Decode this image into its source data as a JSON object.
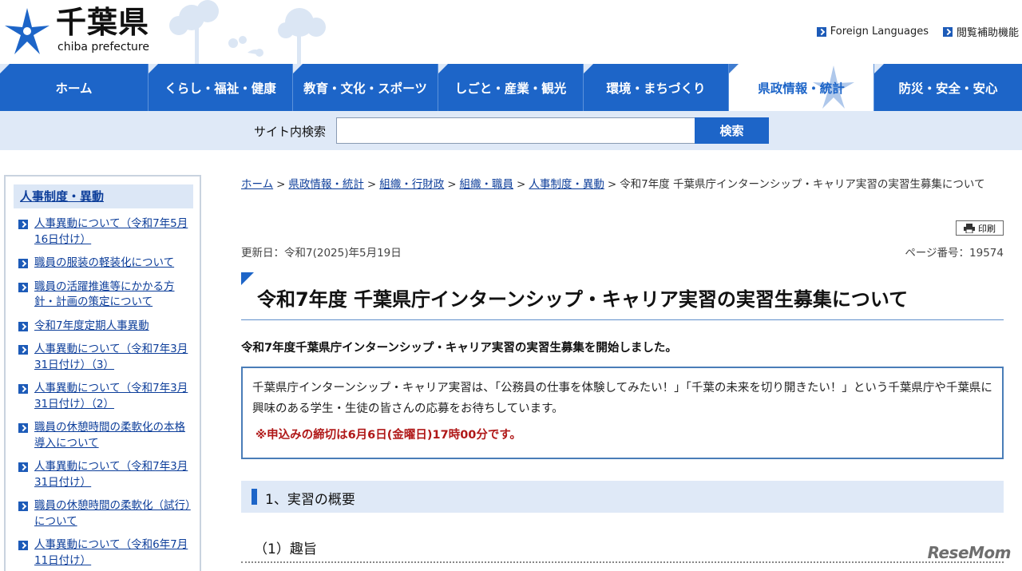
{
  "header": {
    "logo_jp": "千葉県",
    "logo_en": "chiba prefecture",
    "util_links": [
      {
        "label": "Foreign Languages"
      },
      {
        "label": "閲覧補助機能"
      }
    ]
  },
  "gnav": {
    "items": [
      {
        "label": "ホーム"
      },
      {
        "label": "くらし・福祉・健康"
      },
      {
        "label": "教育・文化・スポーツ"
      },
      {
        "label": "しごと・産業・観光"
      },
      {
        "label": "環境・まちづくり"
      },
      {
        "label": "県政情報・統計"
      },
      {
        "label": "防災・安全・安心"
      }
    ],
    "active_index": 5
  },
  "search": {
    "label": "サイト内検索",
    "value": "",
    "button": "検索"
  },
  "sidebar": {
    "heading": "人事制度・異動",
    "items": [
      {
        "label": "人事異動について（令和7年5月16日付け）"
      },
      {
        "label": "職員の服装の軽装化について"
      },
      {
        "label": "職員の活躍推進等にかかる方針・計画の策定について"
      },
      {
        "label": "令和7年度定期人事異動"
      },
      {
        "label": "人事異動について（令和7年3月31日付け）（3）"
      },
      {
        "label": "人事異動について（令和7年3月31日付け）（2）"
      },
      {
        "label": "職員の休憩時間の柔軟化の本格導入について"
      },
      {
        "label": "人事異動について（令和7年3月31日付け）"
      },
      {
        "label": "職員の休憩時間の柔軟化（試行）について"
      },
      {
        "label": "人事異動について（令和6年7月11日付け）"
      }
    ]
  },
  "breadcrumb": {
    "links": [
      "ホーム",
      "県政情報・統計",
      "組織・行財政",
      "組織・職員",
      "人事制度・異動"
    ],
    "separator": ">",
    "current": "令和7年度 千葉県庁インターンシップ・キャリア実習の実習生募集について"
  },
  "print": {
    "label": "印刷"
  },
  "meta": {
    "updated": "更新日：令和7(2025)年5月19日",
    "page_number": "ページ番号：19574"
  },
  "article": {
    "title": "令和7年度 千葉県庁インターンシップ・キャリア実習の実習生募集について",
    "lead": "令和7年度千葉県庁インターンシップ・キャリア実習の実習生募集を開始しました。",
    "notice_body": "千葉県庁インターンシップ・キャリア実習は、「公務員の仕事を体験してみたい！」「千葉の未来を切り開きたい！」という千葉県庁や千葉県に興味のある学生・生徒の皆さんの応募をお待ちしています。",
    "notice_alert": "※申込みの締切は6月6日(金曜日)17時00分です。",
    "h2": "1、実習の概要",
    "h3": "（1）趣旨"
  },
  "watermark": "ReseMom",
  "colors": {
    "brand_blue": "#1d65c8",
    "nav_light": "#dfe9f7",
    "alert_red": "#b01818",
    "link": "#0d3e9a"
  }
}
